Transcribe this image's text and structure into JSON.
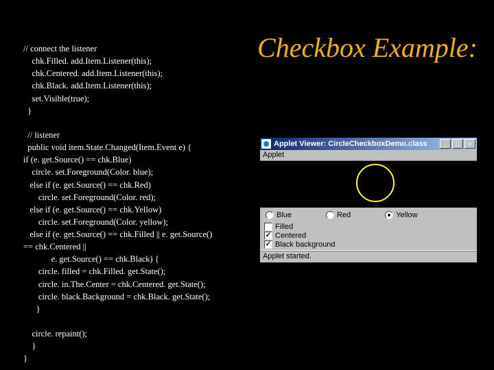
{
  "title": "Checkbox Example:",
  "code1": "// connect the listener\n    chk.Filled. add.Item.Listener(this);\n    chk.Centered. add.Item.Listener(this);\n    chk.Black. add.Item.Listener(this);\n    set.Visible(true);\n  }",
  "code2": "  // listener\n  public void item.State.Changed(Item.Event e) {\nif (e. get.Source() == chk.Blue)\n    circle. set.Foreground(Color. blue);\n   else if (e. get.Source() == chk.Red)\n       circle. set.Foreground(Color. red);\n   else if (e. get.Source() == chk.Yellow)\n       circle. set.Foreground(Color. yellow);\n   else if (e. get.Source() == chk.Filled || e. get.Source()\n== chk.Centered ||\n             e. get.Source() == chk.Black) {\n       circle. filled = chk.Filled. get.State();\n       circle. in.The.Center = chk.Centered. get.State();\n       circle. black.Background = chk.Black. get.State();\n      }\n\n    circle. repaint();\n    }\n}",
  "applet": {
    "title": "Applet Viewer: CircleCheckboxDemo.class",
    "menu": "Applet",
    "radios": {
      "blue": "Blue",
      "red": "Red",
      "yellow": "Yellow"
    },
    "checks": {
      "filled": "Filled",
      "centered": "Centered",
      "black": "Black background"
    },
    "status": "Applet started."
  }
}
